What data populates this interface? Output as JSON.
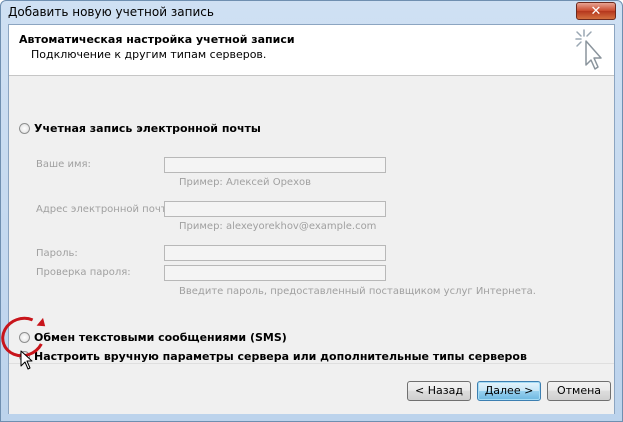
{
  "window": {
    "title": "Добавить новую учетной запись",
    "close_label": "✕"
  },
  "header": {
    "title": "Автоматическая настройка учетной записи",
    "subtitle": "Подключение к другим типам серверов."
  },
  "options": {
    "email_account": "Учетная запись электронной почты",
    "sms": "Обмен текстовыми сообщениями (SMS)",
    "manual": "Настроить вручную параметры сервера или дополнительные типы серверов"
  },
  "selected_option": "manual",
  "fields": {
    "name_label": "Ваше имя:",
    "name_value": "",
    "name_hint": "Пример: Алексей Орехов",
    "email_label": "Адрес электронной почты:",
    "email_value": "",
    "email_hint": "Пример: alexeyorekhov@example.com",
    "password_label": "Пароль:",
    "password_value": "",
    "password_confirm_label": "Проверка пароля:",
    "password_confirm_value": "",
    "password_hint": "Введите пароль, предоставленный поставщиком услуг Интернета."
  },
  "buttons": {
    "back": "< Назад",
    "next": "Далее >",
    "cancel": "Отмена"
  },
  "icons": {
    "header": "cursor-sparkle-icon",
    "close": "close-icon"
  },
  "colors": {
    "highlight_circle": "#c8151b",
    "selected_radio": "#1e6fbf"
  }
}
